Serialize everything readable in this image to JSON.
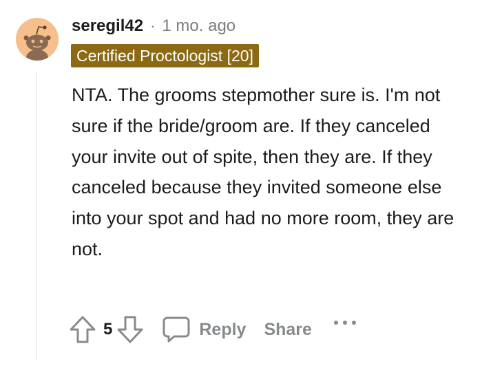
{
  "comment": {
    "username": "seregil42",
    "separator": "·",
    "timestamp": "1 mo. ago",
    "flair": "Certified Proctologist [20]",
    "body": "NTA. The grooms stepmother sure is. I'm not sure if the bride/groom are. If they canceled your invite out of spite, then they are. If they canceled because they invited someone else into your spot and had no more room, they are not.",
    "score": "5",
    "reply_label": "Reply",
    "share_label": "Share"
  },
  "icons": {
    "avatar": "snoo-avatar-icon",
    "upvote": "upvote-arrow-icon",
    "downvote": "downvote-arrow-icon",
    "reply": "speech-bubble-icon",
    "more": "ellipsis-icon"
  },
  "colors": {
    "avatar_bg": "#f6bf8b",
    "flair_bg": "#8c6a13",
    "flair_text": "#ffffff",
    "muted": "#878a8c",
    "text": "#1c1c1c",
    "thread_line": "#edeff1"
  }
}
